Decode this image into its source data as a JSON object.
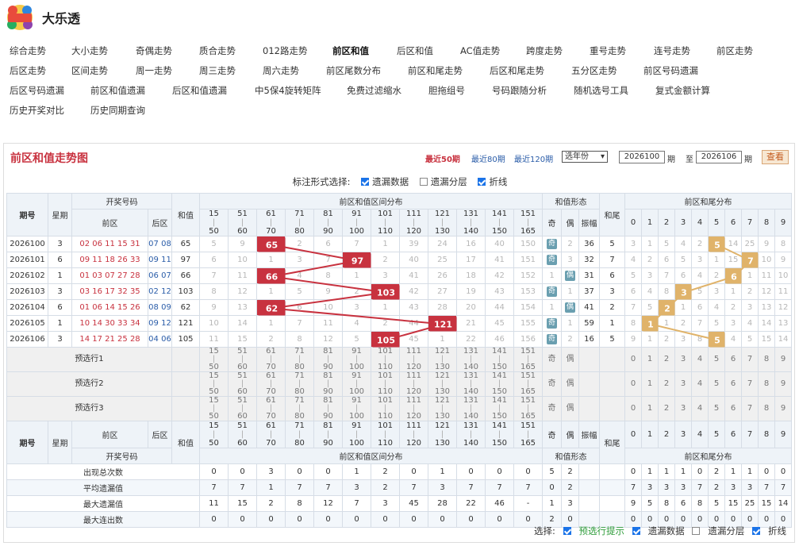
{
  "brand": {
    "title": "大乐透",
    "logo_text": "超级大乐透"
  },
  "nav": [
    [
      "综合走势",
      "大小走势",
      "奇偶走势",
      "质合走势",
      "012路走势",
      "前区和值",
      "后区和值",
      "AC值走势",
      "跨度走势",
      "重号走势",
      "连号走势",
      "前区走势"
    ],
    [
      "后区走势",
      "区间走势",
      "周一走势",
      "周三走势",
      "周六走势",
      "前区尾数分布",
      "前区和尾走势",
      "后区和尾走势",
      "五分区走势",
      "前区号码遗漏"
    ],
    [
      "后区号码遗漏",
      "前区和值遗漏",
      "后区和值遗漏",
      "中5保4旋转矩阵",
      "免费过滤缩水",
      "胆拖组号",
      "号码跟随分析",
      "随机选号工具",
      "复式金额计算"
    ],
    [
      "历史开奖对比",
      "历史同期查询"
    ]
  ],
  "nav_active": "前区和值",
  "panel": {
    "title": "前区和值走势图",
    "links": [
      "最近50期",
      "最近80期",
      "最近120期"
    ],
    "year_select": "选年份",
    "from_issue": "2026100",
    "to_issue": "2026106",
    "issue_label": "期",
    "to_label": "至",
    "query": "查看"
  },
  "options": {
    "label": "标注形式选择:",
    "items": [
      "遗漏数据",
      "遗漏分层",
      "折线"
    ],
    "checked": [
      true,
      false,
      true
    ]
  },
  "headers": {
    "issue": "期号",
    "week": "星期",
    "draw": "开奖号码",
    "front": "前区",
    "back": "后区",
    "sum": "和值",
    "dist": "前区和值区间分布",
    "form": "和值形态",
    "odd": "奇",
    "even": "偶",
    "amp": "振幅",
    "tail": "和尾",
    "taildist": "前区和尾分布"
  },
  "ranges": [
    [
      "15",
      "50"
    ],
    [
      "51",
      "60"
    ],
    [
      "61",
      "70"
    ],
    [
      "71",
      "80"
    ],
    [
      "81",
      "90"
    ],
    [
      "91",
      "100"
    ],
    [
      "101",
      "110"
    ],
    [
      "111",
      "120"
    ],
    [
      "121",
      "130"
    ],
    [
      "131",
      "140"
    ],
    [
      "141",
      "150"
    ],
    [
      "151",
      "165"
    ]
  ],
  "digits": [
    "0",
    "1",
    "2",
    "3",
    "4",
    "5",
    "6",
    "7",
    "8",
    "9"
  ],
  "rows": [
    {
      "issue": "2026100",
      "week": "3",
      "front": "02 06 11 15 31",
      "back": "07 08",
      "sum": "65",
      "ranges": [
        "5",
        "9",
        "65",
        "2",
        "6",
        "7",
        "1",
        "39",
        "24",
        "16",
        "40",
        "150"
      ],
      "odd": "奇",
      "even": "2",
      "amp": "36",
      "tail": "5",
      "tails": [
        "3",
        "1",
        "5",
        "4",
        "2",
        "5",
        "14",
        "25",
        "9",
        "8"
      ]
    },
    {
      "issue": "2026101",
      "week": "6",
      "front": "09 11 18 26 33",
      "back": "09 11",
      "sum": "97",
      "ranges": [
        "6",
        "10",
        "1",
        "3",
        "7",
        "97",
        "2",
        "40",
        "25",
        "17",
        "41",
        "151"
      ],
      "odd": "奇",
      "even": "3",
      "amp": "32",
      "tail": "7",
      "tails": [
        "4",
        "2",
        "6",
        "5",
        "3",
        "1",
        "15",
        "7",
        "10",
        "9"
      ]
    },
    {
      "issue": "2026102",
      "week": "1",
      "front": "01 03 07 27 28",
      "back": "06 07",
      "sum": "66",
      "ranges": [
        "7",
        "11",
        "66",
        "4",
        "8",
        "1",
        "3",
        "41",
        "26",
        "18",
        "42",
        "152"
      ],
      "odd": "1",
      "even": "偶",
      "amp": "31",
      "tail": "6",
      "tails": [
        "5",
        "3",
        "7",
        "6",
        "4",
        "2",
        "6",
        "1",
        "11",
        "10"
      ]
    },
    {
      "issue": "2026103",
      "week": "3",
      "front": "03 16 17 32 35",
      "back": "02 12",
      "sum": "103",
      "ranges": [
        "8",
        "12",
        "1",
        "5",
        "9",
        "2",
        "103",
        "42",
        "27",
        "19",
        "43",
        "153"
      ],
      "odd": "奇",
      "even": "1",
      "amp": "37",
      "tail": "3",
      "tails": [
        "6",
        "4",
        "8",
        "3",
        "5",
        "3",
        "1",
        "2",
        "12",
        "11"
      ]
    },
    {
      "issue": "2026104",
      "week": "6",
      "front": "01 06 14 15 26",
      "back": "08 09",
      "sum": "62",
      "ranges": [
        "9",
        "13",
        "62",
        "6",
        "10",
        "3",
        "1",
        "43",
        "28",
        "20",
        "44",
        "154"
      ],
      "odd": "1",
      "even": "偶",
      "amp": "41",
      "tail": "2",
      "tails": [
        "7",
        "5",
        "2",
        "1",
        "6",
        "4",
        "2",
        "3",
        "13",
        "12"
      ]
    },
    {
      "issue": "2026105",
      "week": "1",
      "front": "10 14 30 33 34",
      "back": "09 12",
      "sum": "121",
      "ranges": [
        "10",
        "14",
        "1",
        "7",
        "11",
        "4",
        "2",
        "44",
        "121",
        "21",
        "45",
        "155"
      ],
      "odd": "奇",
      "even": "1",
      "amp": "59",
      "tail": "1",
      "tails": [
        "8",
        "1",
        "1",
        "2",
        "7",
        "5",
        "3",
        "4",
        "14",
        "13"
      ]
    },
    {
      "issue": "2026106",
      "week": "3",
      "front": "14 17 21 25 28",
      "back": "04 06",
      "sum": "105",
      "ranges": [
        "11",
        "15",
        "2",
        "8",
        "12",
        "5",
        "105",
        "45",
        "1",
        "22",
        "46",
        "156"
      ],
      "odd": "奇",
      "even": "2",
      "amp": "16",
      "tail": "5",
      "tails": [
        "9",
        "1",
        "2",
        "3",
        "8",
        "5",
        "4",
        "5",
        "15",
        "14"
      ]
    }
  ],
  "hit_index": [
    2,
    5,
    2,
    6,
    2,
    8,
    6
  ],
  "tail_hit_index": [
    5,
    7,
    6,
    3,
    2,
    1,
    5
  ],
  "forecast": [
    "预选行1",
    "预选行2",
    "预选行3"
  ],
  "footer_labels": {
    "draw": "开奖号码",
    "dist": "前区和值区间分布",
    "form": "和值形态",
    "taildist": "前区和尾分布"
  },
  "stats": [
    {
      "label": "出现总次数",
      "ranges": [
        "0",
        "0",
        "3",
        "0",
        "0",
        "1",
        "2",
        "0",
        "1",
        "0",
        "0",
        "0"
      ],
      "form": [
        "5",
        "2",
        ""
      ],
      "tails": [
        "0",
        "1",
        "1",
        "1",
        "0",
        "2",
        "1",
        "1",
        "0",
        "0"
      ]
    },
    {
      "label": "平均遗漏值",
      "ranges": [
        "7",
        "7",
        "1",
        "7",
        "7",
        "3",
        "2",
        "7",
        "3",
        "7",
        "7",
        "7"
      ],
      "form": [
        "0",
        "2",
        ""
      ],
      "tails": [
        "7",
        "3",
        "3",
        "3",
        "7",
        "2",
        "3",
        "3",
        "7",
        "7"
      ]
    },
    {
      "label": "最大遗漏值",
      "ranges": [
        "11",
        "15",
        "2",
        "8",
        "12",
        "7",
        "3",
        "45",
        "28",
        "22",
        "46",
        "-"
      ],
      "form": [
        "1",
        "3",
        ""
      ],
      "tails": [
        "9",
        "5",
        "8",
        "6",
        "8",
        "5",
        "15",
        "25",
        "15",
        "14"
      ]
    },
    {
      "label": "最大连出数",
      "ranges": [
        "0",
        "0",
        "0",
        "0",
        "0",
        "0",
        "0",
        "0",
        "0",
        "0",
        "0",
        "0"
      ],
      "form": [
        "2",
        "0",
        ""
      ],
      "tails": [
        "0",
        "0",
        "0",
        "0",
        "0",
        "0",
        "0",
        "0",
        "0",
        "0"
      ]
    }
  ],
  "bottom": {
    "label": "选择:",
    "items": [
      "预选行提示",
      "遗漏数据",
      "遗漏分层",
      "折线"
    ],
    "checked": [
      true,
      true,
      false,
      true
    ]
  },
  "colors": {
    "hit_red": "#c8323f",
    "hit_tail": "#e0b36a",
    "line_red": "#c8323f",
    "line_tail": "#e0b36a"
  }
}
